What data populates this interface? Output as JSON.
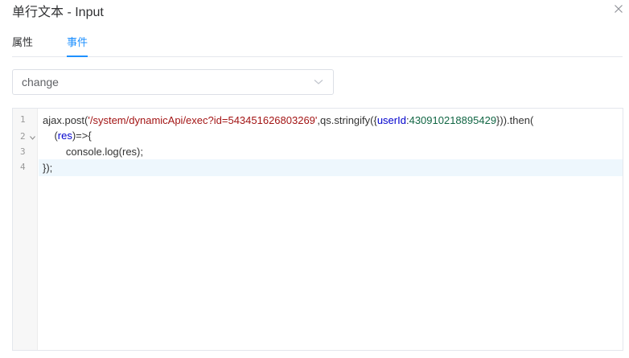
{
  "dialog": {
    "title": "单行文本 - Input",
    "close_icon": "close-icon"
  },
  "tabs": [
    {
      "label": "属性",
      "active": false
    },
    {
      "label": "事件",
      "active": true
    }
  ],
  "event_select": {
    "value": "change",
    "icon": "chevron-down-icon"
  },
  "editor": {
    "gutter": {
      "line_numbers": [
        "1",
        "2",
        "3",
        "4"
      ],
      "fold_icon": "fold-arrow-icon"
    },
    "lines": [
      {
        "tokens": [
          {
            "text": "ajax.post(",
            "kind": "plain"
          },
          {
            "text": "'/system/dynamicApi/exec?id=543451626803269'",
            "kind": "string"
          },
          {
            "text": ",qs.stringify({",
            "kind": "plain"
          },
          {
            "text": "userId",
            "kind": "property"
          },
          {
            "text": ":",
            "kind": "plain"
          },
          {
            "text": "430910218895429",
            "kind": "number"
          },
          {
            "text": "})).then(",
            "kind": "plain"
          }
        ]
      },
      {
        "tokens": [
          {
            "text": "    (",
            "kind": "plain"
          },
          {
            "text": "res",
            "kind": "property"
          },
          {
            "text": ")=>{",
            "kind": "plain"
          }
        ]
      },
      {
        "tokens": [
          {
            "text": "        console.log(res);",
            "kind": "plain"
          }
        ]
      },
      {
        "tokens": [
          {
            "text": "});",
            "kind": "plain"
          }
        ]
      }
    ],
    "active_line": "4"
  },
  "colors": {
    "accent": "#1e90ff",
    "string": "#a31515",
    "number": "#116644",
    "property": "#0000cd",
    "active_line_bg": "#eef7fd"
  }
}
